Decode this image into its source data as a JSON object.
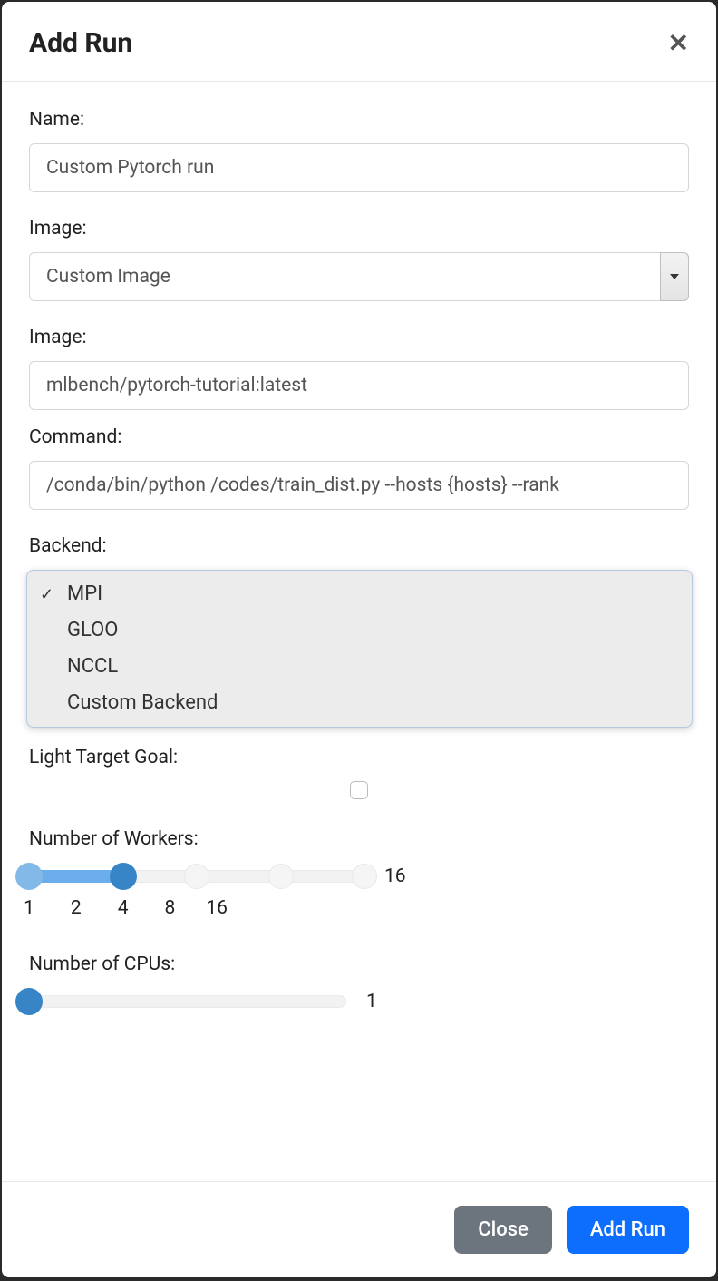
{
  "modal": {
    "title": "Add Run"
  },
  "fields": {
    "name": {
      "label": "Name:",
      "value": "Custom Pytorch run"
    },
    "image_select": {
      "label": "Image:",
      "selected": "Custom Image"
    },
    "image_path": {
      "label": "Image:",
      "value": "mlbench/pytorch-tutorial:latest"
    },
    "command": {
      "label": "Command:",
      "value": "/conda/bin/python /codes/train_dist.py --hosts {hosts} --rank"
    },
    "backend": {
      "label": "Backend:",
      "selected": "MPI",
      "options": [
        "MPI",
        "GLOO",
        "NCCL",
        "Custom Backend"
      ]
    },
    "light_target": {
      "label": "Light Target Goal:",
      "checked": false
    },
    "workers": {
      "label": "Number of Workers:",
      "value": 16,
      "range_low": 1,
      "range_high": 4,
      "ticks": [
        "1",
        "2",
        "4",
        "8",
        "16"
      ]
    },
    "cpus": {
      "label": "Number of CPUs:",
      "value": 1
    }
  },
  "footer": {
    "close": "Close",
    "submit": "Add Run"
  }
}
